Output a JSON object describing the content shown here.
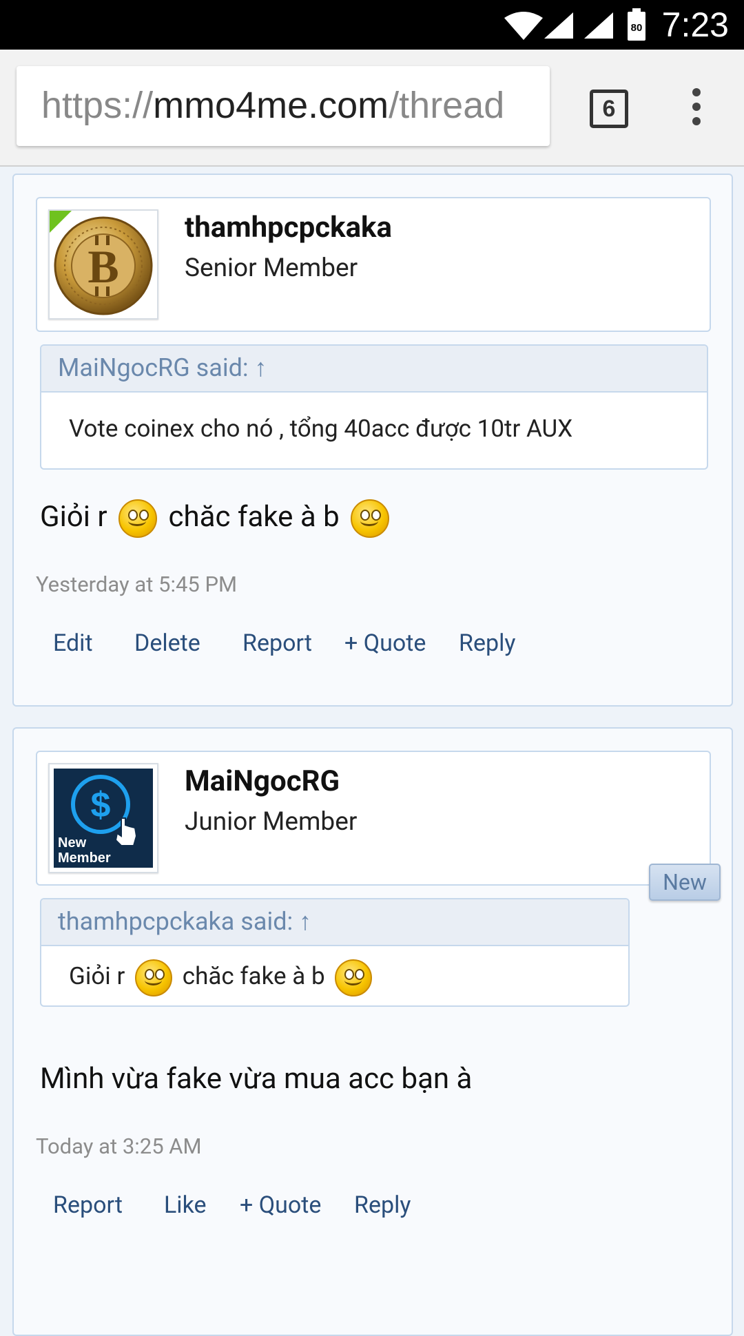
{
  "status_bar": {
    "time": "7:23",
    "battery_level": "80",
    "icons": [
      "wifi-icon",
      "signal-icon",
      "signal-icon",
      "battery-icon"
    ]
  },
  "browser": {
    "url_scheme": "https://",
    "url_host": "mmo4me.com",
    "url_path": "/thread",
    "tab_count": "6",
    "menu_icon": "more-vert-icon"
  },
  "posts": [
    {
      "username": "thamhpcpckaka",
      "user_title": "Senior Member",
      "avatar_icon": "bitcoin-coin-icon",
      "online": true,
      "quote": {
        "header": "MaiNgocRG said: ↑",
        "body": "Vote coinex cho nó , tổng 40acc được 10tr AUX"
      },
      "message_parts": [
        "Giỏi r",
        "chăc fake à b"
      ],
      "date": "Yesterday at 5:45 PM",
      "actions": [
        "Edit",
        "Delete",
        "Report",
        "+ Quote",
        "Reply"
      ]
    },
    {
      "username": "MaiNgocRG",
      "user_title": "Junior Member",
      "avatar_icon": "new-member-dollar-icon",
      "avatar_caption": [
        "New",
        "Member"
      ],
      "new_badge": "New",
      "quote": {
        "header": "thamhpcpckaka said: ↑",
        "body_parts": [
          "Giỏi r",
          "chăc fake à b"
        ]
      },
      "message": "Mình vừa fake vừa mua acc bạn à",
      "date": "Today at 3:25 AM",
      "actions": [
        "Report",
        "Like",
        "+ Quote",
        "Reply"
      ]
    }
  ],
  "colors": {
    "page_bg": "#eef3f9",
    "post_border": "#c6d8ec",
    "link": "#2a4e7b",
    "quote_header_text": "#6a88ac",
    "online": "#6fc21e"
  }
}
